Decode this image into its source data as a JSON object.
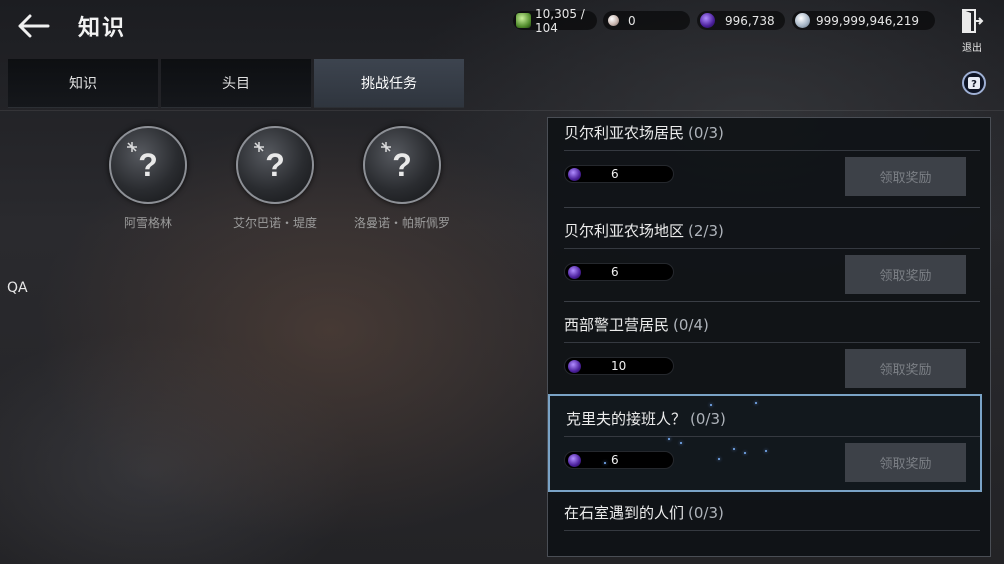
{
  "header": {
    "title": "知识",
    "exit_label": "退出",
    "currencies": [
      {
        "name": "stamina",
        "value": "10,305 / 104"
      },
      {
        "name": "pearl",
        "value": "0"
      },
      {
        "name": "black-gem",
        "value": "996,738"
      },
      {
        "name": "silver",
        "value": "999,999,946,219"
      }
    ]
  },
  "tabs": [
    {
      "label": "知识",
      "active": false
    },
    {
      "label": "头目",
      "active": false
    },
    {
      "label": "挑战任务",
      "active": true
    }
  ],
  "unknown_characters": [
    {
      "symbol": "?",
      "name": "阿雪格林"
    },
    {
      "symbol": "?",
      "name": "艾尔巴诺・堤度"
    },
    {
      "symbol": "?",
      "name": "洛曼诺・帕斯佩罗"
    }
  ],
  "qa_label": "QA",
  "quests": [
    {
      "title": "贝尔利亚农场居民",
      "progress": "(0/3)",
      "reward": "6",
      "button": "领取奖励"
    },
    {
      "title": "贝尔利亚农场地区",
      "progress": "(2/3)",
      "reward": "6",
      "button": "领取奖励"
    },
    {
      "title": "西部警卫营居民",
      "progress": "(0/4)",
      "reward": "10",
      "button": "领取奖励"
    },
    {
      "title": "克里夫的接班人？",
      "progress": "(0/3)",
      "reward": "6",
      "button": "领取奖励"
    },
    {
      "title": "在石室遇到的人们",
      "progress": "(0/3)",
      "reward": "",
      "button": ""
    }
  ],
  "colors": {
    "selected_outline": "#7aa3c6",
    "active_tab": "#3d444f",
    "disabled_button": "#3d4148"
  }
}
